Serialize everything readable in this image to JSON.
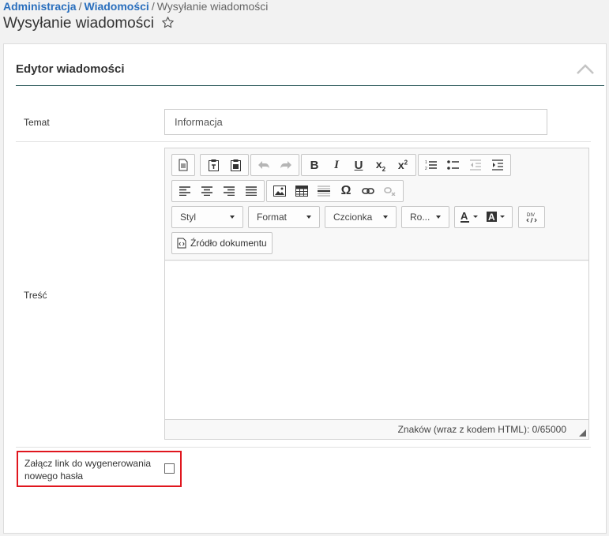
{
  "breadcrumb": {
    "items": [
      "Administracja",
      "Wiadomości"
    ],
    "current": "Wysyłanie wiadomości",
    "separator": "/"
  },
  "page": {
    "title": "Wysyłanie wiadomości",
    "favorite_icon": "star-outline-icon"
  },
  "panel": {
    "title": "Edytor wiadomości",
    "collapse_icon": "chevron-up-icon",
    "accent_color": "#1d4d4f"
  },
  "form": {
    "subject_label": "Temat",
    "subject_value": "Informacja",
    "content_label": "Treść",
    "attach_label": "Załącz link do wygenerowania nowego hasła",
    "attach_checked": false,
    "highlight_color": "#e0161e"
  },
  "editor": {
    "toolbar": {
      "row1": [
        "new-page-icon",
        "paste-text-icon",
        "paste-word-icon",
        "undo-icon",
        "redo-icon",
        "bold-icon",
        "italic-icon",
        "underline-icon",
        "subscript-icon",
        "superscript-icon",
        "numbered-list-icon",
        "bulleted-list-icon",
        "outdent-icon",
        "indent-icon"
      ],
      "row2": [
        "align-left-icon",
        "align-center-icon",
        "align-right-icon",
        "justify-icon",
        "image-icon",
        "table-icon",
        "horizontal-line-icon",
        "special-char-icon",
        "link-icon",
        "unlink-icon"
      ],
      "combos": {
        "style": "Styl",
        "format": "Format",
        "font": "Czcionka",
        "size": "Ro..."
      },
      "text_color_icon": "text-color-icon",
      "bg_color_icon": "background-color-icon",
      "div_icon": "div-container-icon",
      "source_label": "Źródło dokumentu"
    },
    "status": "Znaków (wraz z kodem HTML): 0/65000"
  }
}
